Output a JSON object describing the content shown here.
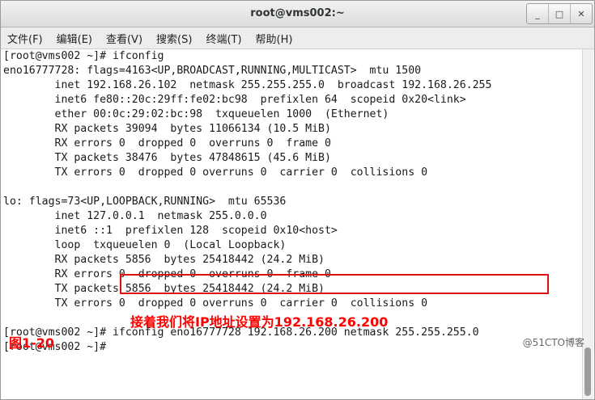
{
  "window": {
    "title": "root@vms002:~",
    "minimize_glyph": "_",
    "maximize_glyph": "□",
    "close_glyph": "✕"
  },
  "menu": [
    "文件(F)",
    "编辑(E)",
    "查看(V)",
    "搜索(S)",
    "终端(T)",
    "帮助(H)"
  ],
  "terminal": {
    "lines": [
      "[root@vms002 ~]# ifconfig",
      "eno16777728: flags=4163<UP,BROADCAST,RUNNING,MULTICAST>  mtu 1500",
      "        inet 192.168.26.102  netmask 255.255.255.0  broadcast 192.168.26.255",
      "        inet6 fe80::20c:29ff:fe02:bc98  prefixlen 64  scopeid 0x20<link>",
      "        ether 00:0c:29:02:bc:98  txqueuelen 1000  (Ethernet)",
      "        RX packets 39094  bytes 11066134 (10.5 MiB)",
      "        RX errors 0  dropped 0  overruns 0  frame 0",
      "        TX packets 38476  bytes 47848615 (45.6 MiB)",
      "        TX errors 0  dropped 0 overruns 0  carrier 0  collisions 0",
      "",
      "lo: flags=73<UP,LOOPBACK,RUNNING>  mtu 65536",
      "        inet 127.0.0.1  netmask 255.0.0.0",
      "        inet6 ::1  prefixlen 128  scopeid 0x10<host>",
      "        loop  txqueuelen 0  (Local Loopback)",
      "        RX packets 5856  bytes 25418442 (24.2 MiB)",
      "        RX errors 0  dropped 0  overruns 0  frame 0",
      "        TX packets 5856  bytes 25418442 (24.2 MiB)",
      "        TX errors 0  dropped 0 overruns 0  carrier 0  collisions 0",
      "",
      "[root@vms002 ~]# ifconfig eno16777728 192.168.26.200 netmask 255.255.255.0",
      "[root@vms002 ~]# "
    ]
  },
  "annotation": {
    "note": "接着我们将IP地址设置为192.168.26.200",
    "figure_label": "图1-20",
    "watermark": "@51CTO博客",
    "highlight_color": "#e01010"
  }
}
